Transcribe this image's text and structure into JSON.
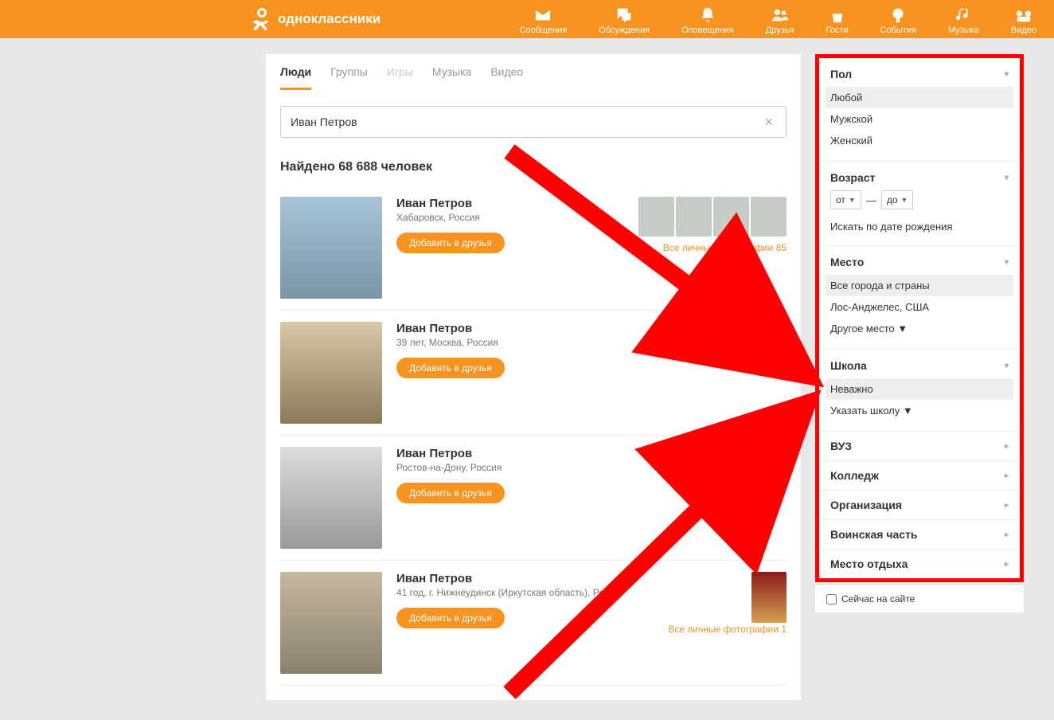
{
  "header": {
    "brand": "одноклассники",
    "nav": [
      {
        "id": "messages",
        "label": "Сообщения"
      },
      {
        "id": "discussions",
        "label": "Обсуждения"
      },
      {
        "id": "notifications",
        "label": "Оповещения"
      },
      {
        "id": "friends",
        "label": "Друзья"
      },
      {
        "id": "guests",
        "label": "Гости"
      },
      {
        "id": "events",
        "label": "События"
      },
      {
        "id": "music",
        "label": "Музыка"
      },
      {
        "id": "video",
        "label": "Видео"
      }
    ]
  },
  "tabs": {
    "people": "Люди",
    "groups": "Группы",
    "games": "Игры",
    "music": "Музыка",
    "video": "Видео"
  },
  "search": {
    "value": "Иван Петров"
  },
  "results": {
    "heading": "Найдено 68 688 человек",
    "add_label": "Добавить в друзья",
    "all_photos_prefix": "Все личные фотографии",
    "items": [
      {
        "name": "Иван Петров",
        "sub": "Хабаровск, Россия",
        "photos_count": 85,
        "thumbs": 4
      },
      {
        "name": "Иван Петров",
        "sub": "39 лет, Москва, Россия"
      },
      {
        "name": "Иван Петров",
        "sub": "Ростов-на-Дону, Россия"
      },
      {
        "name": "Иван Петров",
        "sub": "41 год, г. Нижнеудинск (Иркутская область), Росс…",
        "photos_count": 1,
        "thumbs": 1
      }
    ]
  },
  "filters": {
    "gender": {
      "title": "Пол",
      "options": {
        "any": "Любой",
        "male": "Мужской",
        "female": "Женский"
      }
    },
    "age": {
      "title": "Возраст",
      "from": "от",
      "to": "до",
      "dash": "—",
      "bydob": "Искать по дате рождения"
    },
    "place": {
      "title": "Место",
      "all": "Все города и страны",
      "opt1": "Лос-Анджелес, США",
      "other": "Другое место ▼"
    },
    "school": {
      "title": "Школа",
      "noimportant": "Неважно",
      "specify": "Указать школу ▼"
    },
    "collapsed": {
      "uni": "ВУЗ",
      "college": "Колледж",
      "org": "Организация",
      "military": "Воинская часть",
      "vacation": "Место отдыха"
    },
    "online": "Сейчас на сайте"
  }
}
